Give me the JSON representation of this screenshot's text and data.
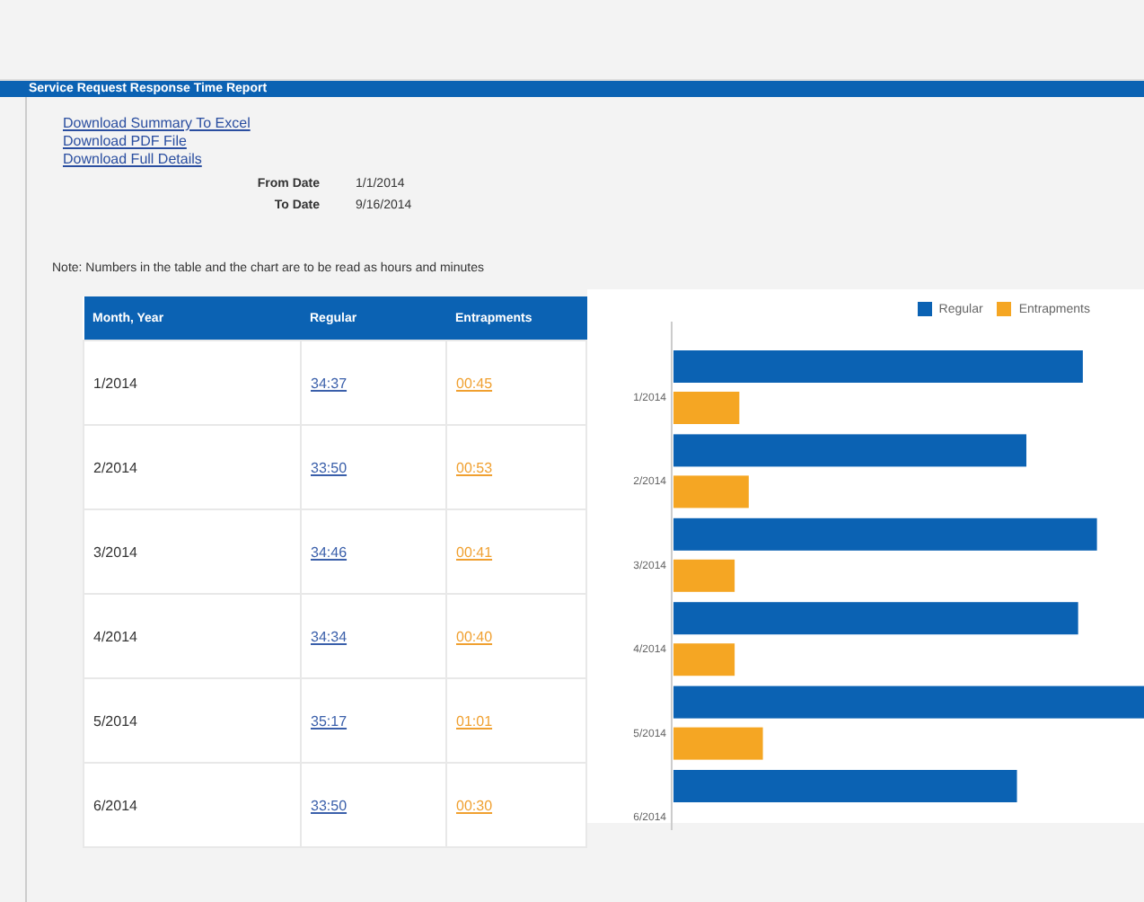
{
  "report": {
    "title": "Service Request Response Time Report"
  },
  "links": [
    "Download Summary To Excel",
    "Download PDF File",
    "Download Full Details"
  ],
  "dates": [
    {
      "label": "From Date",
      "value": "1/1/2014"
    },
    {
      "label": "To Date",
      "value": "9/16/2014"
    }
  ],
  "note": "Note: Numbers in the table and the chart are to be read as hours and minutes",
  "table": {
    "columns": [
      "Month, Year",
      "Regular",
      "Entrapments"
    ],
    "rows": [
      {
        "month": "1/2014",
        "regular": "34:37",
        "entrapments": "00:45"
      },
      {
        "month": "2/2014",
        "regular": "33:50",
        "entrapments": "00:53"
      },
      {
        "month": "3/2014",
        "regular": "34:46",
        "entrapments": "00:41"
      },
      {
        "month": "4/2014",
        "regular": "34:34",
        "entrapments": "00:40"
      },
      {
        "month": "5/2014",
        "regular": "35:17",
        "entrapments": "01:01"
      },
      {
        "month": "6/2014",
        "regular": "33:50",
        "entrapments": "00:30"
      }
    ]
  },
  "chart": {
    "legend": [
      {
        "name": "Regular",
        "color": "#0b62b3"
      },
      {
        "name": "Entrapments",
        "color": "#f5a623"
      }
    ],
    "categories": [
      "1/2014",
      "2/2014",
      "3/2014",
      "4/2014",
      "5/2014",
      "6/2014"
    ]
  }
}
